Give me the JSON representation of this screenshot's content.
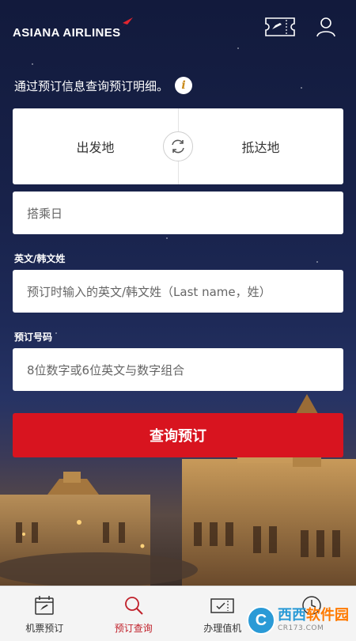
{
  "header": {
    "logo_text": "ASIANA AIRLINES",
    "logo_accent_color": "#e0252f",
    "icons": [
      "ticket-icon",
      "user-icon"
    ]
  },
  "intro": {
    "text": "通过预订信息查询预订明细。",
    "info_badge": "i"
  },
  "route": {
    "from_label": "出发地",
    "to_label": "抵达地",
    "swap_icon": "swap-refresh-icon"
  },
  "fields": {
    "date_placeholder": "搭乘日",
    "name_label": "英文/韩文姓",
    "name_placeholder": "预订时输入的英文/韩文姓（Last name，姓）",
    "code_label": "预订号码",
    "code_placeholder": "8位数字或6位英文与数字组合"
  },
  "search_button": {
    "label": "查询预订",
    "color": "#d8141f"
  },
  "bottom_nav": {
    "items": [
      {
        "label": "机票预订",
        "icon": "calendar-plane-icon",
        "active": false
      },
      {
        "label": "预订查询",
        "icon": "search-icon",
        "active": true
      },
      {
        "label": "办理值机",
        "icon": "boarding-pass-icon",
        "active": false
      },
      {
        "label": "",
        "icon": "clock-icon",
        "active": false
      }
    ],
    "active_color": "#c0202a"
  },
  "watermark": {
    "badge": "C",
    "main_text_a": "西西",
    "main_text_b": "软件园",
    "sub_text": "CR173.COM"
  }
}
